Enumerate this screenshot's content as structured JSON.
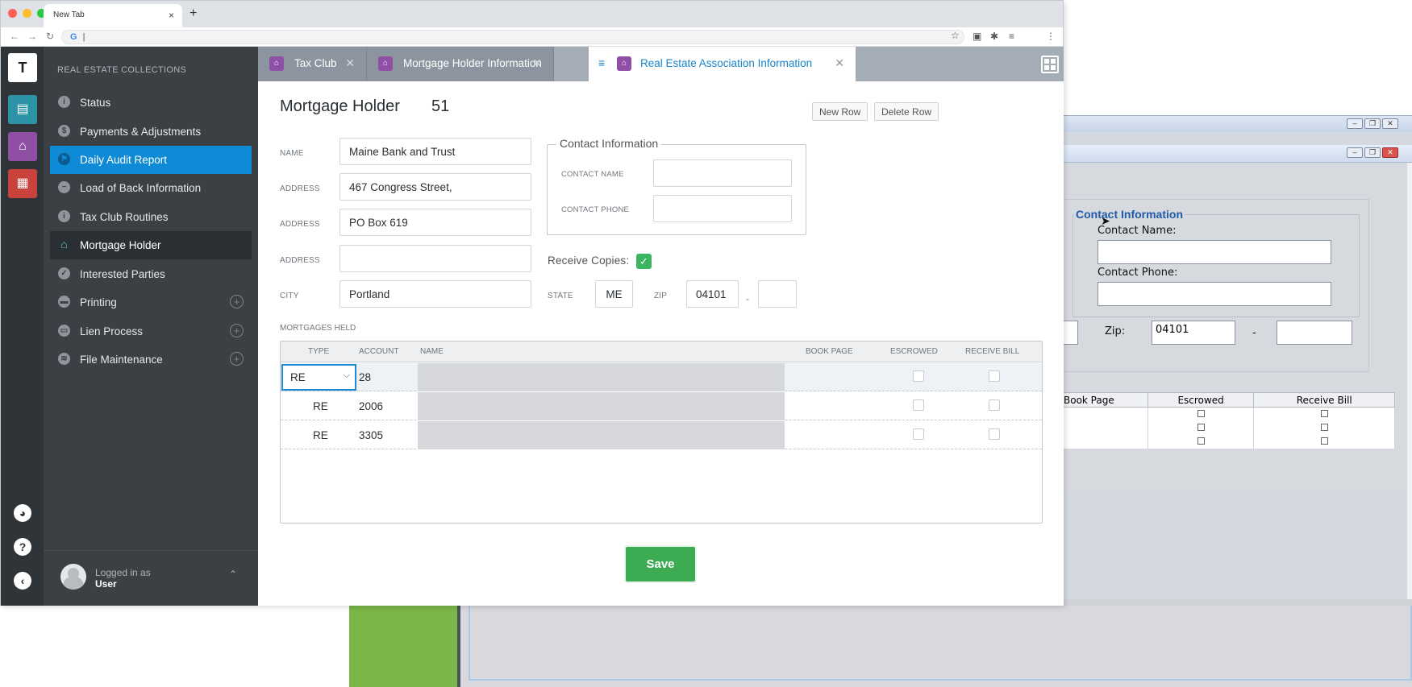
{
  "browser": {
    "tab_title": "New Tab",
    "tab_close": "×",
    "new_tab": "+",
    "address_prefix": "G",
    "address_value": "|"
  },
  "rail": {
    "logo": "T"
  },
  "sidebar": {
    "heading": "REAL ESTATE COLLECTIONS",
    "items": [
      {
        "label": "Status"
      },
      {
        "label": "Payments & Adjustments"
      },
      {
        "label": "Daily Audit Report"
      },
      {
        "label": "Load of Back Information"
      },
      {
        "label": "Tax Club Routines"
      },
      {
        "label": "Mortgage Holder"
      },
      {
        "label": "Interested Parties"
      },
      {
        "label": "Printing"
      },
      {
        "label": "Lien Process"
      },
      {
        "label": "File Maintenance"
      }
    ],
    "user": {
      "line1": "Logged in as",
      "line2": "User"
    }
  },
  "tabs": [
    {
      "label": "Tax Club"
    },
    {
      "label": "Mortgage Holder Information"
    },
    {
      "label": "Real Estate Association Information"
    }
  ],
  "form": {
    "title": "Mortgage Holder",
    "number": "51",
    "new_row": "New Row",
    "delete_row": "Delete Row",
    "name_label": "NAME",
    "name_value": "Maine Bank and Trust",
    "address_label": "ADDRESS",
    "address1": "467 Congress Street,",
    "address2": "PO Box 619",
    "address3": "",
    "city_label": "CITY",
    "city": "Portland",
    "state_label": "STATE",
    "state": "ME",
    "zip_label": "ZIP",
    "zip": "04101",
    "zip_ext": "",
    "zip_dash": "-",
    "contact_title": "Contact Information",
    "contact_name_label": "CONTACT NAME",
    "contact_name": "",
    "contact_phone_label": "CONTACT PHONE",
    "contact_phone": "",
    "receive_copies_label": "Receive Copies:",
    "receive_copies": true,
    "mortgages_label": "MORTGAGES HELD",
    "save": "Save"
  },
  "mortgages": {
    "headers": {
      "type": "TYPE",
      "account": "ACCOUNT",
      "name": "NAME",
      "book_page": "BOOK PAGE",
      "escrowed": "ESCROWED",
      "receive_bill": "RECEIVE BILL"
    },
    "rows": [
      {
        "type": "RE",
        "account": "28"
      },
      {
        "type": "RE",
        "account": "2006"
      },
      {
        "type": "RE",
        "account": "3305"
      }
    ]
  },
  "legacy": {
    "contact_title": "Contact Information",
    "contact_name_label": "Contact Name:",
    "contact_phone_label": "Contact Phone:",
    "zip_label": "Zip:",
    "zip": "04101",
    "dash": "-",
    "headers": {
      "book_page": "Book Page",
      "escrowed": "Escrowed",
      "receive_bill": "Receive Bill"
    }
  },
  "colors": {
    "rail": "#2f3438",
    "sidebar": "#3b4045",
    "active_blue": "#0f8ad6",
    "accent_tab": "#1784c9",
    "save_green": "#3cab52",
    "checkbox_green": "#3cb560",
    "module_icon_purple": "#8e4fa4"
  },
  "icons": {
    "rail": [
      "logo-t",
      "collections-icon",
      "real-estate-icon",
      "calculator-icon",
      "palette-icon",
      "help-icon",
      "collapse-icon"
    ],
    "sidebar": [
      "info-icon",
      "dollar-icon",
      "flag-icon",
      "minus-icon",
      "info-icon",
      "house-icon",
      "thumbs-up-icon",
      "printer-icon",
      "document-icon",
      "layers-icon"
    ]
  }
}
